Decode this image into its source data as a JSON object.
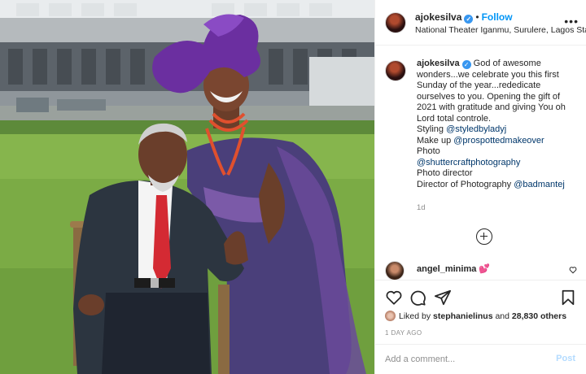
{
  "post": {
    "username": "ajokesilva",
    "follow_label": "Follow",
    "separator": "•",
    "location": "National Theater Iganmu, Surulere, Lagos State",
    "more_label": "•••"
  },
  "caption": {
    "username": "ajokesilva",
    "lines": [
      "God of awesome wonders...we celebrate you this first Sunday of the year...rededicate ourselves to you. Opening the gift of 2021 with gratitude and giving You oh Lord total controle."
    ],
    "styling_label": "Styling",
    "styling_handle": "@styledbyladyj",
    "makeup_label": "Make up",
    "makeup_handle": "@prospottedmakeover",
    "photo_label": "Photo",
    "photo_handle": "@shuttercraftphotography",
    "photo_director": "Photo director",
    "dop_label": "Director of Photography",
    "dop_handle": "@badmantej",
    "age": "1d"
  },
  "comment": {
    "username": "angel_minima",
    "emoji": "💕"
  },
  "actions": {
    "liked_prefix": "Liked by",
    "liked_user": "stephanielinus",
    "liked_suffix": "and",
    "liked_count": "28,830 others",
    "timestamp": "1 DAY AGO"
  },
  "add_comment": {
    "placeholder": "Add a comment...",
    "post_label": "Post"
  },
  "colors": {
    "accent": "#0095f6",
    "mention": "#00376b",
    "verified": "#3897f0",
    "muted": "#8e8e8e"
  },
  "icons": [
    "more-icon",
    "verified-icon",
    "load-more-icon",
    "heart-icon",
    "comment-icon",
    "share-icon",
    "save-icon"
  ]
}
